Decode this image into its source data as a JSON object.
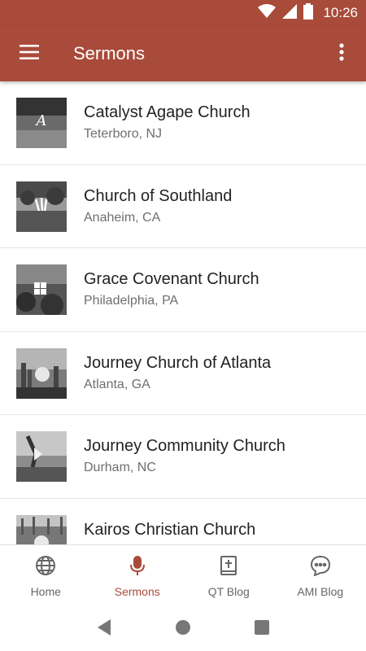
{
  "status": {
    "time": "10:26",
    "icons": [
      "wifi-icon",
      "cell-signal-icon",
      "battery-icon"
    ]
  },
  "appbar": {
    "title": "Sermons",
    "menu_icon": "hamburger-menu-icon",
    "overflow_icon": "more-vert-icon",
    "color": "#a94b3a"
  },
  "churches": [
    {
      "name": "Catalyst Agape Church",
      "location": "Teterboro, NJ"
    },
    {
      "name": "Church of Southland",
      "location": "Anaheim, CA"
    },
    {
      "name": "Grace Covenant Church",
      "location": "Philadelphia, PA"
    },
    {
      "name": "Journey Church of Atlanta",
      "location": "Atlanta, GA"
    },
    {
      "name": "Journey Community Church",
      "location": "Durham, NC"
    },
    {
      "name": "Kairos Christian Church",
      "location": ""
    }
  ],
  "bottom_nav": [
    {
      "label": "Home",
      "icon": "globe-icon",
      "active": false
    },
    {
      "label": "Sermons",
      "icon": "microphone-icon",
      "active": true
    },
    {
      "label": "QT Blog",
      "icon": "bible-icon",
      "active": false
    },
    {
      "label": "AMI Blog",
      "icon": "chat-bubble-icon",
      "active": false
    }
  ],
  "colors": {
    "accent": "#a94b3a",
    "inactive": "#666666"
  }
}
